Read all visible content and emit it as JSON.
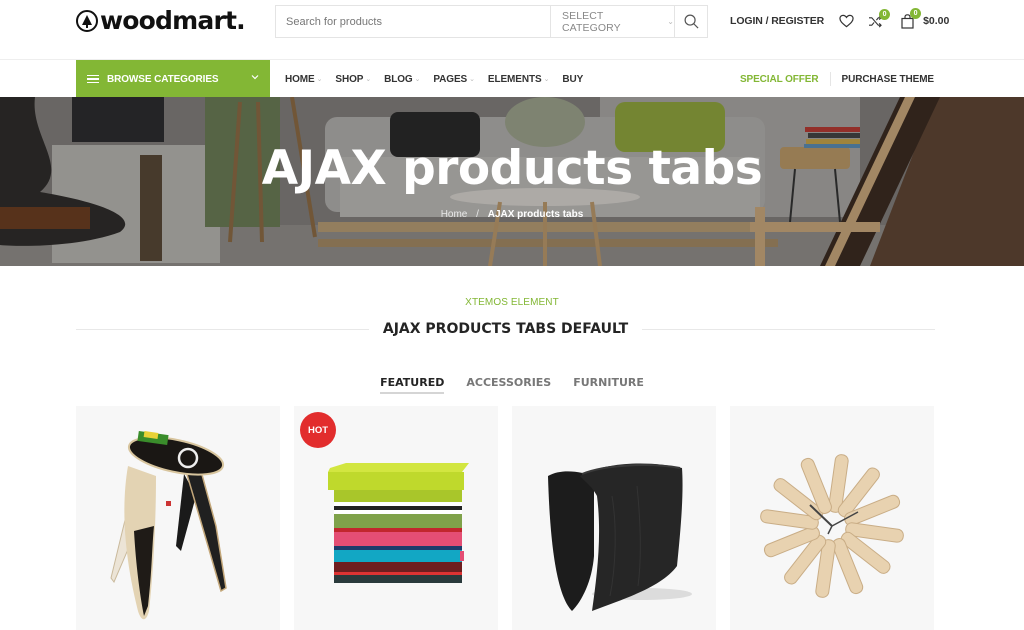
{
  "brand": {
    "name": "woodmart.",
    "logo_icon": "tree-circle-icon",
    "accent_color": "#83b735",
    "hot_color": "#e22d2d"
  },
  "search": {
    "placeholder": "Search for products",
    "category_label": "SELECT CATEGORY",
    "search_icon": "search-icon"
  },
  "header": {
    "login_label": "LOGIN / REGISTER",
    "wishlist_icon": "heart-icon",
    "compare_icon": "shuffle-icon",
    "compare_count": "0",
    "cart_icon": "shopping-bag-icon",
    "cart_count": "0",
    "cart_total": "$0.00"
  },
  "nav": {
    "browse_label": "BROWSE CATEGORIES",
    "menu": [
      {
        "label": "HOME",
        "has_dropdown": true
      },
      {
        "label": "SHOP",
        "has_dropdown": true
      },
      {
        "label": "BLOG",
        "has_dropdown": true
      },
      {
        "label": "PAGES",
        "has_dropdown": true
      },
      {
        "label": "ELEMENTS",
        "has_dropdown": true
      },
      {
        "label": "BUY",
        "has_dropdown": false
      }
    ],
    "special_offer": "SPECIAL OFFER",
    "purchase_theme": "PURCHASE THEME"
  },
  "hero": {
    "title": "AJAX products tabs",
    "breadcrumb": {
      "home": "Home",
      "separator": "/",
      "current": "AJAX products tabs"
    }
  },
  "section": {
    "subtitle": "XTEMOS ELEMENT",
    "title": "AJAX PRODUCTS TABS DEFAULT",
    "tabs": [
      {
        "label": "FEATURED",
        "active": true
      },
      {
        "label": "ACCESSORIES",
        "active": false
      },
      {
        "label": "FURNITURE",
        "active": false
      }
    ]
  },
  "products": [
    {
      "image": "skateboard-stool",
      "badge": null
    },
    {
      "image": "striped-storage-ottoman",
      "badge": "HOT"
    },
    {
      "image": "black-wooden-stool",
      "badge": null
    },
    {
      "image": "wooden-ribbon-wall-clock",
      "badge": null
    }
  ]
}
